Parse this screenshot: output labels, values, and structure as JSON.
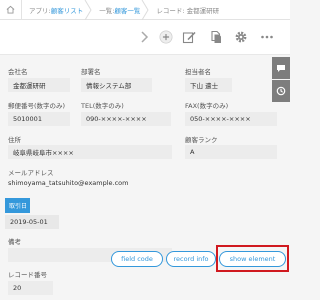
{
  "breadcrumb": {
    "app_prefix": "アプリ:",
    "app_name": "顧客リスト",
    "list_prefix": "一覧:",
    "list_name": "顧客一覧",
    "record_label": "レコード: 金都運研研"
  },
  "toolbar": {
    "icons": [
      "chevron-right-icon",
      "add-icon",
      "edit-icon",
      "duplicate-icon",
      "gear-icon",
      "more-icon"
    ]
  },
  "side_tabs": [
    "comment-icon",
    "history-icon"
  ],
  "fields": {
    "company_name": {
      "label": "会社名",
      "value": "金都運研研"
    },
    "department": {
      "label": "部署名",
      "value": "情報システム部"
    },
    "person_in_charge": {
      "label": "担当者名",
      "value": "下山 遣士"
    },
    "postal_code": {
      "label": "郵便番号(数字のみ)",
      "value": "5010001"
    },
    "tel": {
      "label": "TEL(数字のみ)",
      "value": "090-××××-××××"
    },
    "fax": {
      "label": "FAX(数字のみ)",
      "value": "050-××××-××××"
    },
    "address": {
      "label": "住所",
      "value": "岐阜県岐阜市××××"
    },
    "customer_rank": {
      "label": "顧客ランク",
      "value": "A"
    },
    "email": {
      "label": "メールアドレス",
      "value": "shimoyama_tatsuhito@example.com"
    },
    "section": {
      "label": "取引日"
    },
    "deal_date": {
      "value": "2019-05-01"
    },
    "notes": {
      "label": "備考",
      "value": ""
    },
    "record_number": {
      "label": "レコード番号",
      "value": "20"
    }
  },
  "buttons": {
    "field_code": "field code",
    "record_info": "record info",
    "show_element": "show element"
  },
  "colors": {
    "accent": "#3498db",
    "highlight": "#d0191f",
    "side_tab": "#7d7d7d"
  }
}
